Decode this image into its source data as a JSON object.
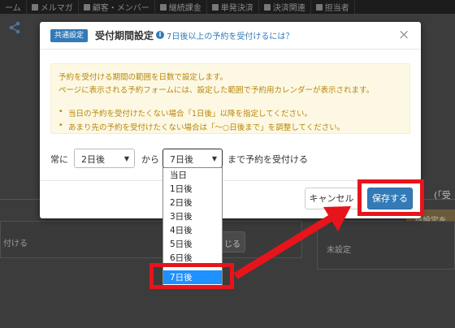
{
  "topnav": {
    "items": [
      "ーム",
      "メルマガ",
      "顧客・メンバー",
      "継続課金",
      "単発決済",
      "決済関連",
      "担当者"
    ]
  },
  "background": {
    "left_box_text": "付ける",
    "close_button": "じる",
    "orange_label": "日設定を",
    "right_text": "(「受",
    "unset_text": "未設定"
  },
  "modal": {
    "badge": "共通設定",
    "title": "受付期間設定",
    "info_icon_glyph": "i",
    "help_link": "7日後以上の予約を受付けるには？",
    "close_glyph": "×",
    "notice": {
      "line1": "予約を受付ける期間の範囲を日数で設定します。",
      "line2": "ページに表示される予約フォームには、設定した範囲で予約用カレンダーが表示されます。",
      "bullet1": "当日の予約を受付けたくない場合「1日後」以降を指定してください。",
      "bullet2": "あまり先の予約を受付けたくない場合は「〜○日後まで」を調整してください。"
    },
    "row": {
      "prefix": "常に",
      "from_value": "2日後",
      "middle": "から",
      "to_value": "7日後",
      "suffix": "まで予約を受付ける"
    },
    "cancel_label": "キャンセル",
    "save_label": "保存する"
  },
  "dropdown": {
    "options": [
      "当日",
      "1日後",
      "2日後",
      "3日後",
      "4日後",
      "5日後",
      "6日後",
      "7日後"
    ],
    "selected": "7日後"
  },
  "annotation_color": "#e8141b"
}
